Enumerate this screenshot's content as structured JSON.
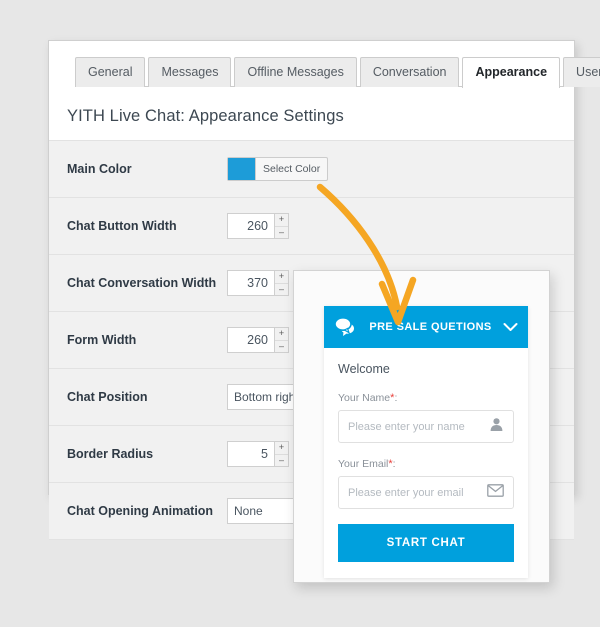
{
  "tabs": [
    {
      "label": "General",
      "active": false
    },
    {
      "label": "Messages",
      "active": false
    },
    {
      "label": "Offline Messages",
      "active": false
    },
    {
      "label": "Conversation",
      "active": false
    },
    {
      "label": "Appearance",
      "active": true
    },
    {
      "label": "Users",
      "active": false
    }
  ],
  "page_title": "YITH Live Chat: Appearance Settings",
  "settings": {
    "main_color": {
      "label": "Main Color",
      "button_label": "Select Color",
      "value": "#1d9cd8"
    },
    "chat_button_width": {
      "label": "Chat Button Width",
      "value": "260"
    },
    "chat_conversation_width": {
      "label": "Chat Conversation Width",
      "value": "370"
    },
    "form_width": {
      "label": "Form Width",
      "value": "260"
    },
    "chat_position": {
      "label": "Chat Position",
      "value": "Bottom right corner"
    },
    "border_radius": {
      "label": "Border Radius",
      "value": "5"
    },
    "chat_opening_animation": {
      "label": "Chat Opening Animation",
      "value": "None"
    }
  },
  "spinner": {
    "increment": "+",
    "decrement": "–"
  },
  "chat_widget": {
    "header_title": "PRE SALE QUETIONS",
    "welcome_text": "Welcome",
    "name_field": {
      "label": "Your Name",
      "required_mark": "*",
      "colon": ":",
      "placeholder": "Please enter your name"
    },
    "email_field": {
      "label": "Your Email",
      "required_mark": "*",
      "colon": ":",
      "placeholder": "Please enter your email"
    },
    "start_button_label": "START CHAT"
  },
  "colors": {
    "accent_blue": "#00a0dd",
    "arrow_orange": "#f5a623",
    "required_red": "#e8413c",
    "page_background": "#e7e7e7"
  }
}
